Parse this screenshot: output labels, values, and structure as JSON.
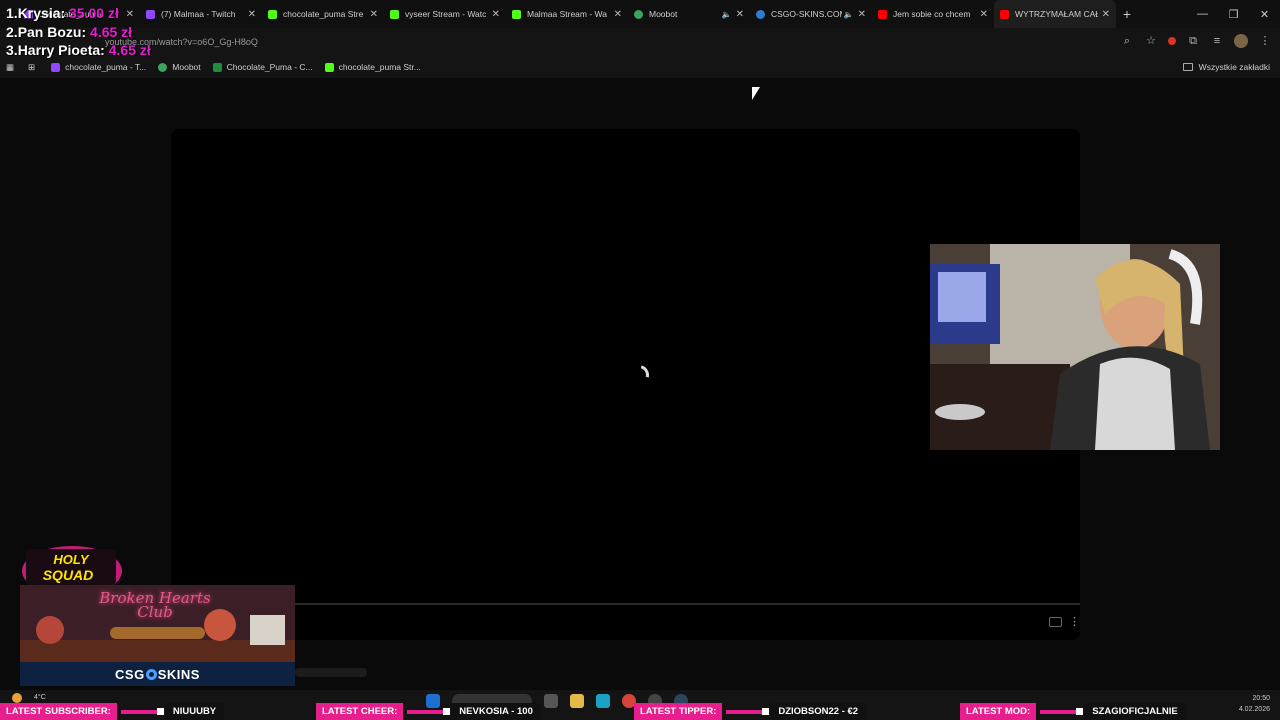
{
  "browser": {
    "tabs": [
      {
        "label": "chocolate_puma",
        "color": "#9146ff"
      },
      {
        "label": "(7) Malmaa - Twitch",
        "color": "#9146ff"
      },
      {
        "label": "chocolate_puma Stre",
        "color": "#53fc18"
      },
      {
        "label": "vyseer Stream - Watc",
        "color": "#53fc18"
      },
      {
        "label": "Malmaa Stream - Wa",
        "color": "#53fc18"
      },
      {
        "label": "Moobot",
        "color": "#3aa55d"
      },
      {
        "label": "CSGO-SKINS.COM",
        "color": "#2d7dd2"
      },
      {
        "label": "Jem sobie co chcem",
        "color": "#ff0000"
      },
      {
        "label": "WYTRZYMAŁAM CAŁ",
        "color": "#ff0000"
      }
    ],
    "url": "youtube.com/watch?v=o6O_Gg-H8oQ",
    "bookmarks": [
      {
        "label": "chocolate_puma - T...",
        "color": "#9146ff"
      },
      {
        "label": "Moobot",
        "color": "#3aa55d"
      },
      {
        "label": "Chocolate_Puma - C...",
        "color": "#1e8e3e"
      },
      {
        "label": "chocolate_puma Str...",
        "color": "#53fc18"
      }
    ],
    "all_bookmarks": "Wszystkie zakładki"
  },
  "overlay": {
    "tips": [
      {
        "rank": "1.",
        "name": "Krysia:",
        "amount": "35.00 zł"
      },
      {
        "rank": "2.",
        "name": "Pan Bozu:",
        "amount": "4.65 zł"
      },
      {
        "rank": "3.",
        "name": "Harry Pioeta:",
        "amount": "4.65 zł"
      }
    ],
    "holy_squad": "HOLY SQUAD",
    "club_title": "Broken Hearts Club",
    "sponsor": {
      "left": "CSG",
      "right": "SKINS"
    }
  },
  "taskbar": {
    "temperature": "4°C",
    "time": "20:50",
    "date": "4.02.2026"
  },
  "ticker": {
    "subscriber_label": "LATEST SUBSCRIBER:",
    "subscriber_value": "NIUUUBY",
    "cheer_label": "LATEST CHEER:",
    "cheer_value": "NEVKOSIA - 100",
    "tipper_label": "LATEST TIPPER:",
    "tipper_value": "DZIOBSON22 - €2",
    "mod_label": "LATEST MOD:",
    "mod_value": "SZAGIOFICJALNIE"
  }
}
